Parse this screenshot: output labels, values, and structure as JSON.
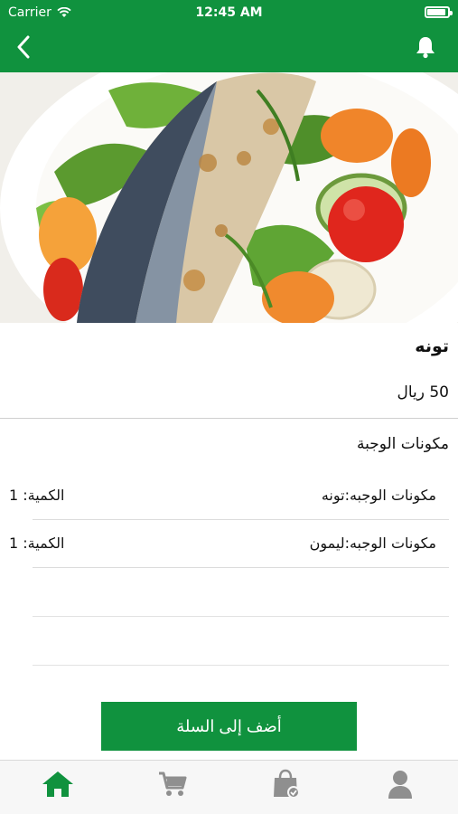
{
  "status_bar": {
    "carrier": "Carrier",
    "time": "12:45 AM",
    "battery_level": 1.0
  },
  "colors": {
    "brand": "#10923e",
    "icon_inactive": "#8f8f8f",
    "text": "#111111"
  },
  "nav": {
    "back_icon": "chevron-left-icon",
    "bell_icon": "bell-icon"
  },
  "meal": {
    "name": "تونه",
    "price": "50 ريال"
  },
  "ingredients_section": {
    "title": "مكونات الوجبة",
    "items": [
      {
        "name": "مكونات الوجبه:تونه",
        "quantity": "الكمية: 1"
      },
      {
        "name": "مكونات الوجبه:ليمون",
        "quantity": "الكمية: 1"
      }
    ]
  },
  "actions": {
    "add_to_cart": "أضف إلى السلة"
  },
  "tabs": [
    {
      "icon": "home-icon",
      "active": true
    },
    {
      "icon": "cart-icon",
      "active": false
    },
    {
      "icon": "orders-bag-icon",
      "active": false
    },
    {
      "icon": "profile-icon",
      "active": false
    }
  ]
}
